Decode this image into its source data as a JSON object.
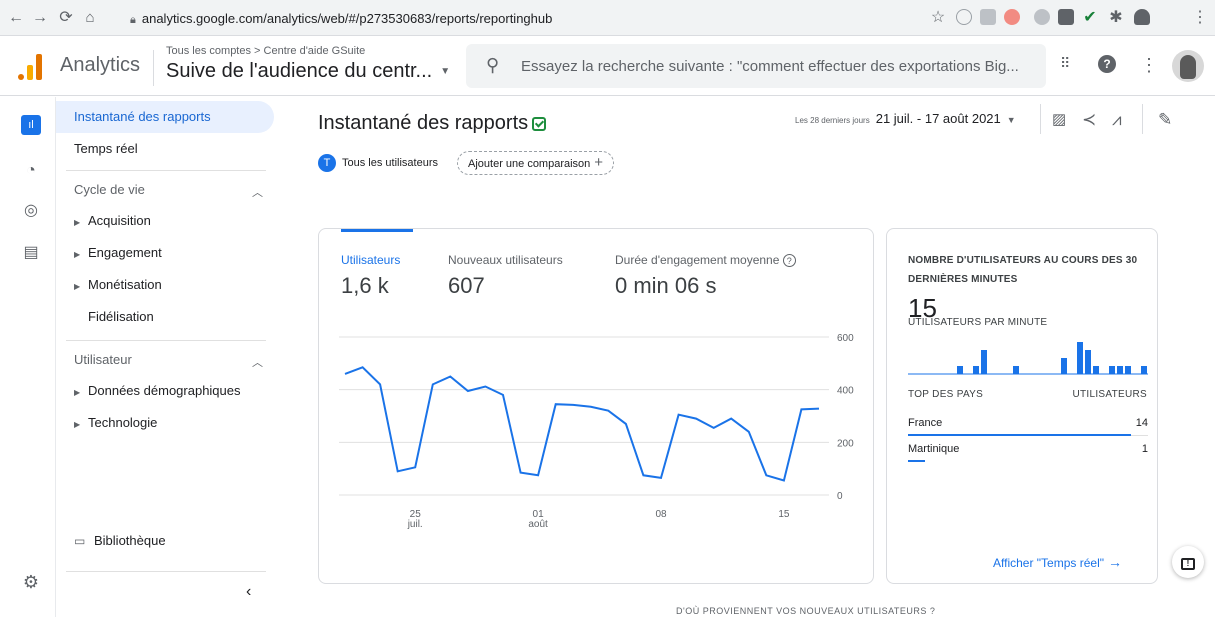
{
  "browser": {
    "url": "analytics.google.com/analytics/web/#/p273530683/reports/reportinghub"
  },
  "header": {
    "app_name": "Analytics",
    "breadcrumb": "Tous les comptes > Centre d'aide GSuite",
    "property": "Suive de l'audience du centr...",
    "search_placeholder": "Essayez la recherche suivante : \"comment effectuer des exportations Big..."
  },
  "sidebar": {
    "items": [
      {
        "label": "Instantané des rapports"
      },
      {
        "label": "Temps réel"
      }
    ],
    "lifecycle": {
      "title": "Cycle de vie",
      "items": [
        "Acquisition",
        "Engagement",
        "Monétisation",
        "Fidélisation"
      ]
    },
    "user": {
      "title": "Utilisateur",
      "items": [
        "Données démographiques",
        "Technologie"
      ]
    },
    "library": "Bibliothèque"
  },
  "main": {
    "title": "Instantané des rapports",
    "date_range_label": "Les 28 derniers jours",
    "date_range": "21 juil. - 17 août 2021",
    "comparison": {
      "chip": "Tous les utilisateurs",
      "chip_initial": "T",
      "add": "Ajouter une comparaison"
    }
  },
  "metrics": [
    {
      "label": "Utilisateurs",
      "value": "1,6 k"
    },
    {
      "label": "Nouveaux utilisateurs",
      "value": "607"
    },
    {
      "label": "Durée d'engagement moyenne",
      "value": "0 min 06 s"
    }
  ],
  "chart_data": {
    "type": "line",
    "title": "",
    "xlabel": "",
    "ylabel": "",
    "ylim": [
      0,
      600
    ],
    "yticks": [
      0,
      200,
      400,
      600
    ],
    "x_ticks": [
      {
        "day": "25",
        "month": "juil."
      },
      {
        "day": "01",
        "month": "août"
      },
      {
        "day": "08",
        "month": ""
      },
      {
        "day": "15",
        "month": ""
      }
    ],
    "x": [
      "21 juil.",
      "22 juil.",
      "23 juil.",
      "24 juil.",
      "25 juil.",
      "26 juil.",
      "27 juil.",
      "28 juil.",
      "29 juil.",
      "30 juil.",
      "31 juil.",
      "01 août",
      "02 août",
      "03 août",
      "04 août",
      "05 août",
      "06 août",
      "07 août",
      "08 août",
      "09 août",
      "10 août",
      "11 août",
      "12 août",
      "13 août",
      "14 août",
      "15 août",
      "16 août",
      "17 août"
    ],
    "series": [
      {
        "values": [
          460,
          485,
          420,
          90,
          105,
          420,
          450,
          395,
          412,
          380,
          85,
          75,
          345,
          342,
          335,
          320,
          270,
          75,
          65,
          305,
          290,
          255,
          290,
          240,
          75,
          55,
          325,
          328
        ]
      }
    ],
    "grid": true,
    "color": "#1a73e8"
  },
  "realtime": {
    "title": "NOMBRE D'UTILISATEURS AU COURS DES 30 DERNIÈRES MINUTES",
    "count": "15",
    "subtitle": "UTILISATEURS PAR MINUTE",
    "per_minute": [
      0,
      0,
      0,
      0,
      0,
      0,
      1,
      0,
      1,
      3,
      0,
      0,
      0,
      1,
      0,
      0,
      0,
      0,
      0,
      2,
      0,
      4,
      3,
      1,
      0,
      1,
      1,
      1,
      0,
      1
    ],
    "top_countries_header": "TOP DES PAYS",
    "users_header": "UTILISATEURS",
    "countries": [
      {
        "name": "France",
        "count": "14",
        "share": 0.93
      },
      {
        "name": "Martinique",
        "count": "1",
        "share": 0.07
      }
    ],
    "link": "Afficher \"Temps réel\""
  },
  "footer_text": "D'OÙ PROVIENNENT VOS NOUVEAUX UTILISATEURS ?",
  "colors": {
    "accent": "#1a73e8",
    "active_bg": "#e8f0fe",
    "logo_orange": "#f9ab00",
    "logo_dark": "#e37400"
  }
}
